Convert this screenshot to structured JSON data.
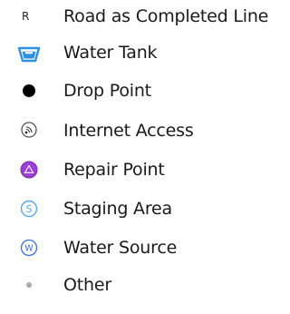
{
  "legend": {
    "items": [
      {
        "label": "Road as Completed Line",
        "icon": "road-letter-r-icon",
        "icon_text": "R",
        "color": "#222222"
      },
      {
        "label": "Water Tank",
        "icon": "water-tank-icon",
        "color": "#2f8fe0"
      },
      {
        "label": "Drop Point",
        "icon": "drop-point-dot-icon",
        "color": "#000000"
      },
      {
        "label": "Internet Access",
        "icon": "internet-access-icon",
        "color": "#444444"
      },
      {
        "label": "Repair Point",
        "icon": "repair-point-triangle-icon",
        "color": "#9a3fd6"
      },
      {
        "label": "Staging Area",
        "icon": "staging-area-s-icon",
        "icon_text": "S",
        "color": "#5aa7f0"
      },
      {
        "label": "Water Source",
        "icon": "water-source-w-icon",
        "icon_text": "W",
        "color": "#3b6fd6"
      },
      {
        "label": "Other",
        "icon": "other-dot-icon",
        "color": "#aaaaaa"
      }
    ]
  }
}
